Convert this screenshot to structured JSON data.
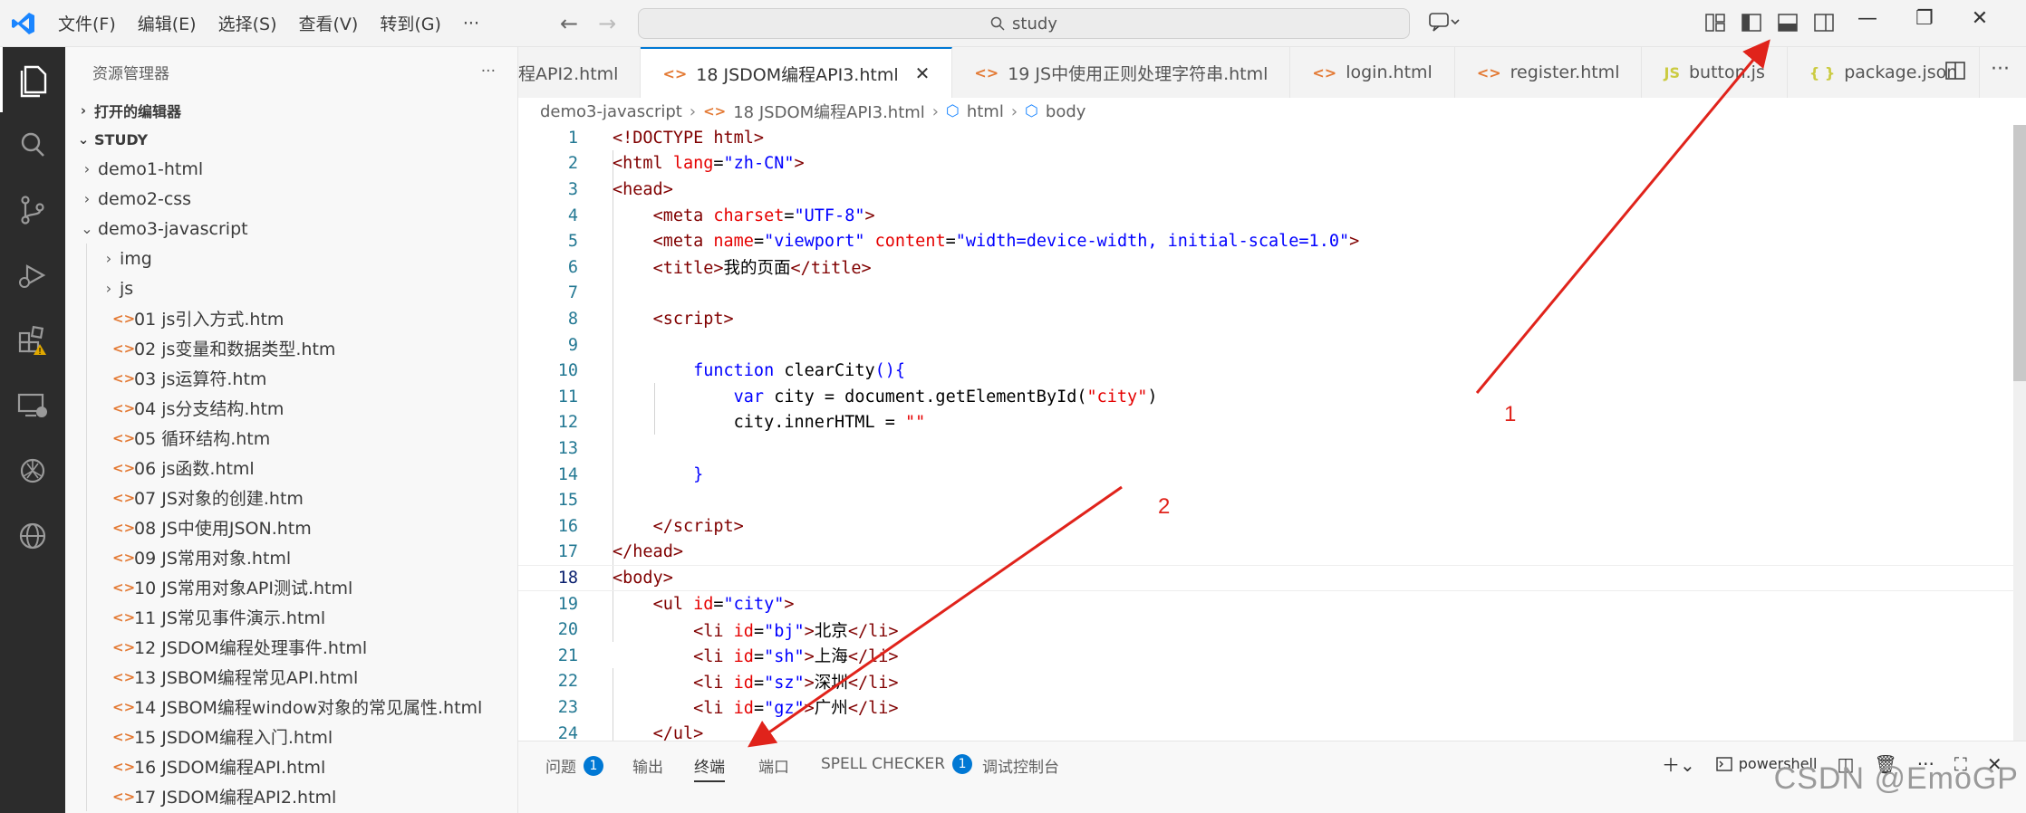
{
  "titlebar": {
    "menu": [
      "文件(F)",
      "编辑(E)",
      "选择(S)",
      "查看(V)",
      "转到(G)",
      "···"
    ],
    "search_text": "study"
  },
  "sidebar": {
    "title": "资源管理器",
    "open_editors": "打开的编辑器",
    "workspace": "STUDY",
    "folders": [
      "demo1-html",
      "demo2-css",
      "demo3-javascript"
    ],
    "subfolders": [
      "img",
      "js"
    ],
    "files": [
      "01 js引入方式.htm",
      "02 js变量和数据类型.htm",
      "03 js运算符.htm",
      "04 js分支结构.htm",
      "05 循环结构.htm",
      "06 js函数.html",
      "07 JS对象的创建.htm",
      "08 JS中使用JSON.htm",
      "09 JS常用对象.html",
      "10 JS常用对象API测试.html",
      "11 JS常见事件演示.html",
      "12 JSDOM编程处理事件.html",
      "13 JSBOM编程常见API.html",
      "14 JSBOM编程window对象的常见属性.html",
      "15 JSDOM编程入门.html",
      "16 JSDOM编程API.html",
      "17 JSDOM编程API2.html"
    ]
  },
  "tabs": [
    {
      "label": "程API2.html",
      "icon": "<>"
    },
    {
      "label": "18 JSDOM编程API3.html",
      "icon": "<>",
      "active": true
    },
    {
      "label": "19 JS中使用正则处理字符串.html",
      "icon": "<>"
    },
    {
      "label": "login.html",
      "icon": "<>"
    },
    {
      "label": "register.html",
      "icon": "<>"
    },
    {
      "label": "button.js",
      "icon": "JS"
    },
    {
      "label": "package.json",
      "icon": "{ }"
    }
  ],
  "breadcrumb": {
    "folder": "demo3-javascript",
    "file": "18 JSDOM编程API3.html",
    "html": "html",
    "body": "body"
  },
  "panel": {
    "tabs": [
      "问题",
      "输出",
      "终端",
      "端口",
      "SPELL CHECKER",
      "调试控制台"
    ],
    "problems_count": "1",
    "spell_count": "1",
    "terminal_type": "powershell"
  },
  "annotations": {
    "label1": "1",
    "label2": "2"
  },
  "watermark": "CSDN @EmoGP",
  "colors": {
    "accent": "#0078d4",
    "annotation": "#e0231b",
    "activitybar": "#2c2c2c"
  }
}
